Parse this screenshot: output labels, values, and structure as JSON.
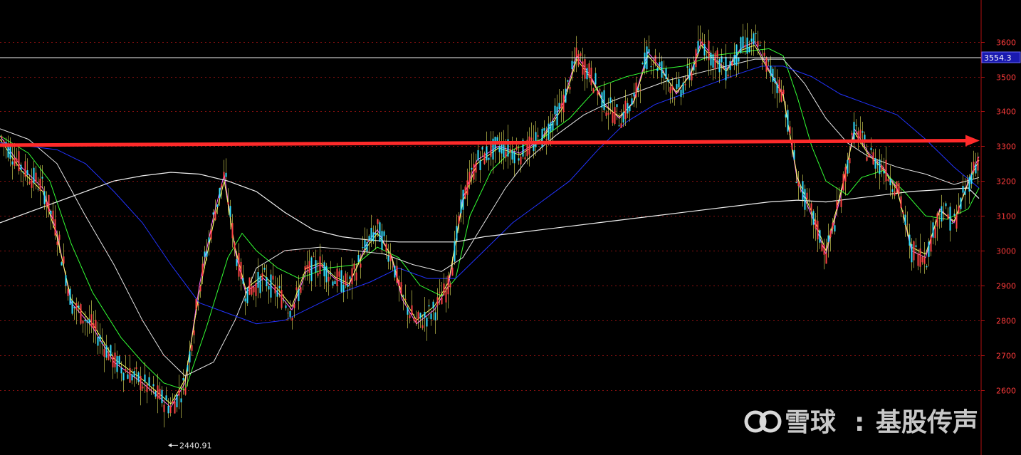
{
  "chart_data": {
    "type": "candlestick",
    "yaxis": {
      "ticks": [
        2600,
        2700,
        2800,
        2900,
        3000,
        3100,
        3200,
        3300,
        3400,
        3500,
        3600
      ],
      "ylim": [
        2413,
        3720
      ]
    },
    "current_price": {
      "value": 3554.3,
      "label": "3554.3"
    },
    "low_marker": {
      "value": 2440.91,
      "label": "2440.91"
    },
    "annotation": {
      "type": "horizontal-arrow",
      "level_start": 3303,
      "level_end": 3316,
      "color": "#ff2a2a"
    },
    "grid": true,
    "candle_colors": {
      "up": "#ff4444",
      "down": "#33e0ff",
      "wick": "#ffff66"
    },
    "moving_averages": [
      {
        "color": "#ff66ff",
        "points": [
          [
            0,
            3330
          ],
          [
            30,
            3240
          ],
          [
            60,
            3180
          ],
          [
            80,
            3050
          ],
          [
            100,
            2850
          ],
          [
            130,
            2780
          ],
          [
            160,
            2680
          ],
          [
            200,
            2620
          ],
          [
            240,
            2550
          ],
          [
            260,
            2620
          ],
          [
            280,
            2900
          ],
          [
            300,
            3100
          ],
          [
            315,
            3220
          ],
          [
            330,
            3000
          ],
          [
            345,
            2880
          ],
          [
            370,
            2920
          ],
          [
            390,
            2880
          ],
          [
            410,
            2830
          ],
          [
            430,
            2940
          ],
          [
            450,
            2960
          ],
          [
            470,
            2920
          ],
          [
            490,
            2900
          ],
          [
            515,
            3020
          ],
          [
            530,
            3060
          ],
          [
            550,
            2980
          ],
          [
            565,
            2860
          ],
          [
            585,
            2790
          ],
          [
            610,
            2830
          ],
          [
            630,
            2900
          ],
          [
            650,
            3150
          ],
          [
            670,
            3260
          ],
          [
            700,
            3300
          ],
          [
            730,
            3280
          ],
          [
            760,
            3320
          ],
          [
            790,
            3420
          ],
          [
            810,
            3560
          ],
          [
            830,
            3500
          ],
          [
            850,
            3420
          ],
          [
            870,
            3380
          ],
          [
            890,
            3430
          ],
          [
            910,
            3570
          ],
          [
            930,
            3520
          ],
          [
            950,
            3450
          ],
          [
            970,
            3510
          ],
          [
            985,
            3600
          ],
          [
            1000,
            3560
          ],
          [
            1020,
            3520
          ],
          [
            1040,
            3580
          ],
          [
            1060,
            3600
          ],
          [
            1080,
            3520
          ],
          [
            1100,
            3450
          ],
          [
            1120,
            3200
          ],
          [
            1140,
            3100
          ],
          [
            1160,
            2990
          ],
          [
            1180,
            3150
          ],
          [
            1200,
            3350
          ],
          [
            1220,
            3280
          ],
          [
            1240,
            3240
          ],
          [
            1260,
            3180
          ],
          [
            1280,
            3000
          ],
          [
            1300,
            2980
          ],
          [
            1320,
            3120
          ],
          [
            1340,
            3080
          ],
          [
            1360,
            3200
          ],
          [
            1375,
            3270
          ]
        ]
      },
      {
        "color": "#ffff66",
        "points": [
          [
            0,
            3320
          ],
          [
            30,
            3230
          ],
          [
            60,
            3170
          ],
          [
            80,
            3040
          ],
          [
            100,
            2860
          ],
          [
            130,
            2790
          ],
          [
            160,
            2690
          ],
          [
            200,
            2630
          ],
          [
            240,
            2560
          ],
          [
            260,
            2630
          ],
          [
            280,
            2880
          ],
          [
            300,
            3080
          ],
          [
            315,
            3200
          ],
          [
            330,
            3010
          ],
          [
            345,
            2890
          ],
          [
            370,
            2930
          ],
          [
            390,
            2890
          ],
          [
            410,
            2840
          ],
          [
            430,
            2950
          ],
          [
            450,
            2965
          ],
          [
            470,
            2925
          ],
          [
            490,
            2905
          ],
          [
            515,
            3010
          ],
          [
            530,
            3050
          ],
          [
            550,
            2985
          ],
          [
            565,
            2870
          ],
          [
            585,
            2800
          ],
          [
            610,
            2840
          ],
          [
            630,
            2910
          ],
          [
            650,
            3140
          ],
          [
            670,
            3250
          ],
          [
            700,
            3295
          ],
          [
            730,
            3275
          ],
          [
            760,
            3315
          ],
          [
            790,
            3410
          ],
          [
            810,
            3550
          ],
          [
            830,
            3495
          ],
          [
            850,
            3415
          ],
          [
            870,
            3385
          ],
          [
            890,
            3425
          ],
          [
            910,
            3560
          ],
          [
            930,
            3515
          ],
          [
            950,
            3455
          ],
          [
            970,
            3505
          ],
          [
            985,
            3590
          ],
          [
            1000,
            3555
          ],
          [
            1020,
            3515
          ],
          [
            1040,
            3575
          ],
          [
            1060,
            3590
          ],
          [
            1080,
            3515
          ],
          [
            1100,
            3445
          ],
          [
            1120,
            3210
          ],
          [
            1140,
            3110
          ],
          [
            1160,
            3000
          ],
          [
            1180,
            3160
          ],
          [
            1200,
            3340
          ],
          [
            1220,
            3275
          ],
          [
            1240,
            3235
          ],
          [
            1260,
            3175
          ],
          [
            1280,
            3010
          ],
          [
            1300,
            2990
          ],
          [
            1320,
            3115
          ],
          [
            1340,
            3085
          ],
          [
            1360,
            3195
          ],
          [
            1375,
            3260
          ]
        ]
      },
      {
        "color": "#33ff33",
        "points": [
          [
            0,
            3330
          ],
          [
            40,
            3280
          ],
          [
            70,
            3200
          ],
          [
            100,
            3020
          ],
          [
            130,
            2880
          ],
          [
            170,
            2750
          ],
          [
            200,
            2680
          ],
          [
            230,
            2620
          ],
          [
            260,
            2600
          ],
          [
            290,
            2780
          ],
          [
            320,
            2980
          ],
          [
            340,
            3050
          ],
          [
            360,
            3000
          ],
          [
            390,
            2950
          ],
          [
            420,
            2920
          ],
          [
            460,
            2950
          ],
          [
            500,
            2960
          ],
          [
            530,
            3010
          ],
          [
            560,
            2980
          ],
          [
            590,
            2900
          ],
          [
            620,
            2870
          ],
          [
            640,
            2920
          ],
          [
            660,
            3100
          ],
          [
            690,
            3230
          ],
          [
            720,
            3290
          ],
          [
            760,
            3320
          ],
          [
            800,
            3380
          ],
          [
            840,
            3470
          ],
          [
            880,
            3500
          ],
          [
            920,
            3520
          ],
          [
            960,
            3530
          ],
          [
            1000,
            3560
          ],
          [
            1040,
            3570
          ],
          [
            1080,
            3580
          ],
          [
            1100,
            3560
          ],
          [
            1120,
            3440
          ],
          [
            1140,
            3300
          ],
          [
            1160,
            3200
          ],
          [
            1190,
            3160
          ],
          [
            1210,
            3210
          ],
          [
            1240,
            3230
          ],
          [
            1270,
            3170
          ],
          [
            1300,
            3100
          ],
          [
            1330,
            3090
          ],
          [
            1360,
            3120
          ],
          [
            1375,
            3180
          ]
        ]
      },
      {
        "color": "#e6e6e6",
        "points": [
          [
            0,
            3350
          ],
          [
            40,
            3320
          ],
          [
            80,
            3250
          ],
          [
            120,
            3100
          ],
          [
            160,
            2960
          ],
          [
            200,
            2800
          ],
          [
            230,
            2700
          ],
          [
            260,
            2640
          ],
          [
            300,
            2680
          ],
          [
            330,
            2800
          ],
          [
            360,
            2950
          ],
          [
            400,
            3000
          ],
          [
            450,
            3010
          ],
          [
            500,
            3000
          ],
          [
            540,
            2990
          ],
          [
            580,
            2960
          ],
          [
            620,
            2940
          ],
          [
            650,
            2980
          ],
          [
            680,
            3080
          ],
          [
            710,
            3180
          ],
          [
            740,
            3260
          ],
          [
            780,
            3330
          ],
          [
            820,
            3390
          ],
          [
            860,
            3430
          ],
          [
            900,
            3460
          ],
          [
            940,
            3490
          ],
          [
            980,
            3510
          ],
          [
            1020,
            3530
          ],
          [
            1060,
            3550
          ],
          [
            1100,
            3550
          ],
          [
            1130,
            3480
          ],
          [
            1160,
            3380
          ],
          [
            1190,
            3310
          ],
          [
            1220,
            3270
          ],
          [
            1260,
            3240
          ],
          [
            1300,
            3220
          ],
          [
            1340,
            3190
          ],
          [
            1375,
            3210
          ]
        ]
      },
      {
        "color": "#2233ff",
        "points": [
          [
            0,
            3310
          ],
          [
            40,
            3300
          ],
          [
            80,
            3290
          ],
          [
            120,
            3250
          ],
          [
            160,
            3170
          ],
          [
            200,
            3080
          ],
          [
            240,
            2960
          ],
          [
            280,
            2850
          ],
          [
            320,
            2820
          ],
          [
            360,
            2790
          ],
          [
            400,
            2800
          ],
          [
            440,
            2840
          ],
          [
            480,
            2880
          ],
          [
            520,
            2910
          ],
          [
            560,
            2950
          ],
          [
            600,
            2920
          ],
          [
            640,
            2920
          ],
          [
            680,
            3000
          ],
          [
            720,
            3080
          ],
          [
            760,
            3140
          ],
          [
            800,
            3200
          ],
          [
            840,
            3290
          ],
          [
            880,
            3370
          ],
          [
            920,
            3420
          ],
          [
            960,
            3450
          ],
          [
            1000,
            3480
          ],
          [
            1040,
            3510
          ],
          [
            1070,
            3530
          ],
          [
            1100,
            3530
          ],
          [
            1140,
            3500
          ],
          [
            1180,
            3450
          ],
          [
            1220,
            3420
          ],
          [
            1260,
            3390
          ],
          [
            1300,
            3320
          ],
          [
            1340,
            3240
          ],
          [
            1375,
            3180
          ]
        ]
      },
      {
        "color": "#f0f0f0",
        "points": [
          [
            0,
            3080
          ],
          [
            40,
            3110
          ],
          [
            80,
            3140
          ],
          [
            120,
            3170
          ],
          [
            160,
            3200
          ],
          [
            200,
            3215
          ],
          [
            240,
            3225
          ],
          [
            280,
            3220
          ],
          [
            320,
            3200
          ],
          [
            360,
            3170
          ],
          [
            400,
            3110
          ],
          [
            440,
            3060
          ],
          [
            480,
            3040
          ],
          [
            520,
            3030
          ],
          [
            560,
            3025
          ],
          [
            600,
            3025
          ],
          [
            640,
            3025
          ],
          [
            680,
            3040
          ],
          [
            720,
            3050
          ],
          [
            760,
            3060
          ],
          [
            800,
            3070
          ],
          [
            840,
            3080
          ],
          [
            880,
            3090
          ],
          [
            920,
            3100
          ],
          [
            960,
            3110
          ],
          [
            1000,
            3120
          ],
          [
            1040,
            3130
          ],
          [
            1080,
            3140
          ],
          [
            1120,
            3145
          ],
          [
            1160,
            3140
          ],
          [
            1200,
            3150
          ],
          [
            1240,
            3160
          ],
          [
            1280,
            3170
          ],
          [
            1320,
            3175
          ],
          [
            1360,
            3180
          ],
          [
            1375,
            3150
          ]
        ]
      }
    ]
  },
  "watermark": {
    "brand": "雪球",
    "separator": ":",
    "author": "基股传声"
  }
}
